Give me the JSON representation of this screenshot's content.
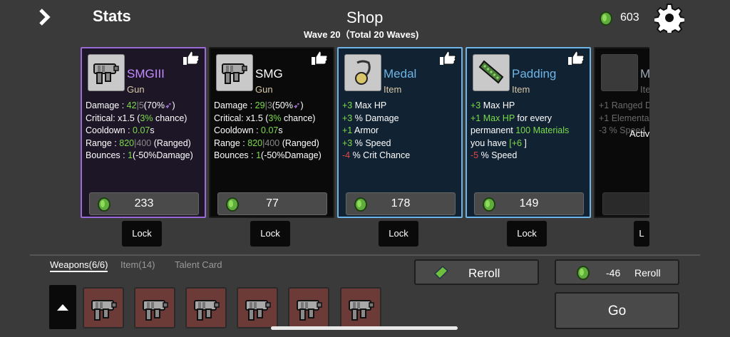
{
  "header": {
    "stats_label": "Stats",
    "shop_title": "Shop",
    "wave_text": "Wave 20（Total 20 Waves)",
    "materials": "603"
  },
  "cards": [
    {
      "name": "SMGIII",
      "type": "Gun",
      "tier": "purple",
      "price": "233",
      "stats": [
        [
          [
            "w",
            "Damage : "
          ],
          [
            "g",
            "42"
          ],
          [
            "gr",
            "|"
          ],
          [
            "gr",
            "5"
          ],
          [
            "w",
            "(70%"
          ],
          [
            "pp",
            "➶"
          ],
          [
            "w",
            ")"
          ]
        ],
        [
          [
            "w",
            "Critical: x1.5 ("
          ],
          [
            "g",
            "3%"
          ],
          [
            "w",
            " chance)"
          ]
        ],
        [
          [
            "w",
            "Cooldown : "
          ],
          [
            "g",
            "0.07"
          ],
          [
            "w",
            "s"
          ]
        ],
        [
          [
            "w",
            "Range : "
          ],
          [
            "g",
            "820"
          ],
          [
            "gr",
            "|"
          ],
          [
            "gr",
            "400"
          ],
          [
            "w",
            " (Ranged)"
          ]
        ],
        [
          [
            "w",
            "Bounces : "
          ],
          [
            "g",
            "1"
          ],
          [
            "w",
            "(-50%Damage)"
          ]
        ]
      ]
    },
    {
      "name": "SMG",
      "type": "Gun",
      "tier": "black",
      "price": "77",
      "stats": [
        [
          [
            "w",
            "Damage : "
          ],
          [
            "g",
            "29"
          ],
          [
            "gr",
            "|"
          ],
          [
            "gr",
            "3"
          ],
          [
            "w",
            "(50%"
          ],
          [
            "pp",
            "➶"
          ],
          [
            "w",
            ")"
          ]
        ],
        [
          [
            "w",
            "Critical: x1.5 ("
          ],
          [
            "g",
            "3%"
          ],
          [
            "w",
            " chance)"
          ]
        ],
        [
          [
            "w",
            "Cooldown : "
          ],
          [
            "g",
            "0.07"
          ],
          [
            "w",
            "s"
          ]
        ],
        [
          [
            "w",
            "Range : "
          ],
          [
            "g",
            "820"
          ],
          [
            "gr",
            "|"
          ],
          [
            "gr",
            "400"
          ],
          [
            "w",
            " (Ranged)"
          ]
        ],
        [
          [
            "w",
            "Bounces : "
          ],
          [
            "g",
            "1"
          ],
          [
            "w",
            "(-50%Damage)"
          ]
        ]
      ]
    },
    {
      "name": "Medal",
      "type": "Item",
      "tier": "blue",
      "price": "178",
      "stats": [
        [
          [
            "g",
            "+3"
          ],
          [
            "w",
            " Max HP"
          ]
        ],
        [
          [
            "g",
            "+3"
          ],
          [
            "w",
            " % Damage"
          ]
        ],
        [
          [
            "g",
            "+1"
          ],
          [
            "w",
            " Armor"
          ]
        ],
        [
          [
            "g",
            "+3"
          ],
          [
            "w",
            " % Speed"
          ]
        ],
        [
          [
            "r",
            "-4"
          ],
          [
            "w",
            " % Crit Chance"
          ]
        ]
      ]
    },
    {
      "name": "Padding",
      "type": "Item",
      "tier": "blue",
      "price": "149",
      "stats": [
        [
          [
            "g",
            "+3"
          ],
          [
            "w",
            " Max HP"
          ]
        ],
        [
          [
            "g",
            "+1  Max HP"
          ],
          [
            "w",
            " for every"
          ]
        ],
        [
          [
            "w",
            "permanent "
          ],
          [
            "g",
            "100 Materials"
          ]
        ],
        [
          [
            "w",
            "you have "
          ],
          [
            "g",
            "[+6"
          ],
          [
            "w",
            " ]"
          ]
        ],
        [
          [
            "r",
            "-5"
          ],
          [
            "w",
            " % Speed"
          ]
        ]
      ]
    }
  ],
  "partial_card": {
    "line1": "+1 Ranged D",
    "line2": "+1 Elementa",
    "line3": "-3 % Speed",
    "active": "Activ",
    "name_prefix": "M",
    "type_prefix": "Ite",
    "lock_prefix": "L"
  },
  "lock_label": "Lock",
  "tabs": {
    "weapons": "Weapons(6/6)",
    "items": "Item(14)",
    "talent": "Talent Card"
  },
  "reroll": {
    "label": "Reroll",
    "cost_text": "-46",
    "cost_label": "Reroll"
  },
  "go_label": "Go",
  "colors": {
    "bg": "#3a3a3a",
    "green": "#7bdc4a",
    "red": "#e24545",
    "purple_border": "#9a6ad6",
    "blue_border": "#6fb4e6"
  }
}
